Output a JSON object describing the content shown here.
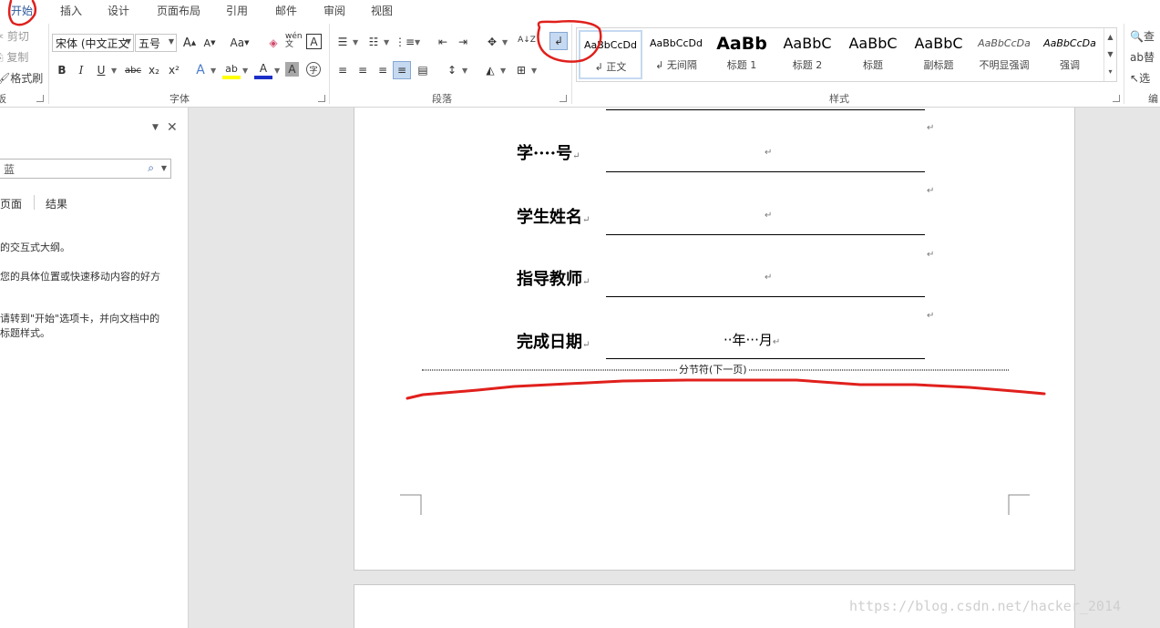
{
  "tabs": [
    "开始",
    "插入",
    "设计",
    "页面布局",
    "引用",
    "邮件",
    "审阅",
    "视图"
  ],
  "clipboard": {
    "cut": "剪切",
    "copy": "复制",
    "format_painter": "格式刷",
    "group_label": "板"
  },
  "font": {
    "name": "宋体 (中文正文",
    "size": "五号",
    "group_label": "字体",
    "buttons": {
      "grow": "A",
      "shrink": "A",
      "case": "Aa",
      "phonetic": "wén文",
      "border_char": "A",
      "bold": "B",
      "italic": "I",
      "underline": "U",
      "strike": "abc",
      "sub": "x₂",
      "sup": "x²",
      "effects": "A",
      "highlight": "ab",
      "color": "A",
      "shading": "A",
      "enclose": "字"
    }
  },
  "paragraph": {
    "group_label": "段落",
    "sort": "A↓Z",
    "show_marks_icon": "paragraph-mark-icon"
  },
  "styles": {
    "group_label": "样式",
    "items": [
      {
        "preview": "AaBbCcDd",
        "name": "↲ 正文"
      },
      {
        "preview": "AaBbCcDd",
        "name": "↲ 无间隔"
      },
      {
        "preview": "AaBb",
        "name": "标题 1"
      },
      {
        "preview": "AaBbC",
        "name": "标题 2"
      },
      {
        "preview": "AaBbC",
        "name": "标题"
      },
      {
        "preview": "AaBbC",
        "name": "副标题"
      },
      {
        "preview": "AaBbCcDa",
        "name": "不明显强调"
      },
      {
        "preview": "AaBbCcDa",
        "name": "强调"
      }
    ]
  },
  "editing": {
    "find": "查",
    "replace": "替",
    "select": "选",
    "group_label": "编"
  },
  "nav": {
    "search_placeholder": "蓝",
    "tabs": [
      "页面",
      "结果"
    ],
    "line1": "的交互式大纲。",
    "line2": "您的具体位置或快速移动内容的好方",
    "line3": "请转到\"开始\"选项卡，并向文档中的",
    "line4": "标题样式。"
  },
  "document": {
    "fields": [
      {
        "label": "学····号"
      },
      {
        "label": "学生姓名"
      },
      {
        "label": "指导教师"
      },
      {
        "label": "完成日期",
        "value": "··年···月"
      }
    ],
    "paragraph_mark": "↵",
    "section_break": "分节符(下一页)"
  },
  "watermark": "https://blog.csdn.net/hacker_2014",
  "colors": {
    "accent": "#2b579a",
    "annotation_red": "#e0201c",
    "selected": "#c5d9f1"
  }
}
